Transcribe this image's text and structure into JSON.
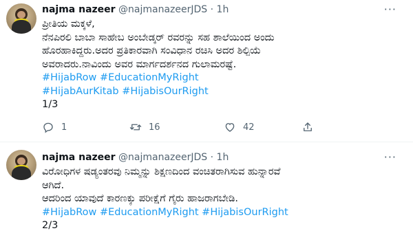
{
  "tweets": [
    {
      "name": "najma nazeer",
      "handle": "@najmanazeerJDS",
      "sep": "·",
      "time": "1h",
      "more": "···",
      "lines": [
        "ಪ್ರೀತಿಯ ಮಕ್ಕಳೆ,",
        "ನೆನಪಿರಲಿ ಬಾಬಾ ಸಾಹೇಬ ಅಂಬೇಡ್ಕರ್ ರವರನ್ನು ಸಹ ಶಾಲೆಯಿಂದ ಅಂದು",
        "ಹೊರಹಾಕಿದ್ದರು.ಅದರ ಪ್ರತಿಕಾರವಾಗಿ ಸಂವಿಧಾನ ರಚಿಸಿ ಅದರ ಶಿಲ್ಪಿಯೆ",
        "ಅವರಾದರು.ನಾವಿಂದು ಅವರ ಮಾರ್ಗದರ್ಶನದ ಗುಲಾಮರಷ್ಟೆ."
      ],
      "hashtags_line1": "#HijabRow #EducationMyRight",
      "hashtags_line2": "#HijabAurKitab #HijabisOurRight",
      "counter": "1/3",
      "reply_count": "1",
      "retweet_count": "16",
      "like_count": "42"
    },
    {
      "name": "najma nazeer",
      "handle": "@najmanazeerJDS",
      "sep": "·",
      "time": "1h",
      "more": "···",
      "lines": [
        "ವಿರೋಧಿಗಳ ಷಡ್ಯಂತರವು ನಿಮ್ಮನ್ನು ಶಿಕ್ಷಣದಿಂದ ವಂಚಿತರಾಗಿಸುವ ಹುನ್ನಾರವೆ",
        "ಆಗಿದೆ.",
        "ಆದರಿಂದ ಯಾವುದೆ ಕಾರಣಕ್ಕು ಪರೀಕ್ಷೆಗೆ ಗೈರು ಹಾಜರಾಗಬೇಡಿ."
      ],
      "hashtags_line1": "#HijabRow #EducationMyRight #HijabisOurRight",
      "counter": "2/3"
    }
  ],
  "colors": {
    "link": "#1d9bf0",
    "secondary": "#536471",
    "text": "#0f1419"
  },
  "icons": [
    "reply-icon",
    "retweet-icon",
    "like-icon",
    "share-icon",
    "more-icon"
  ]
}
